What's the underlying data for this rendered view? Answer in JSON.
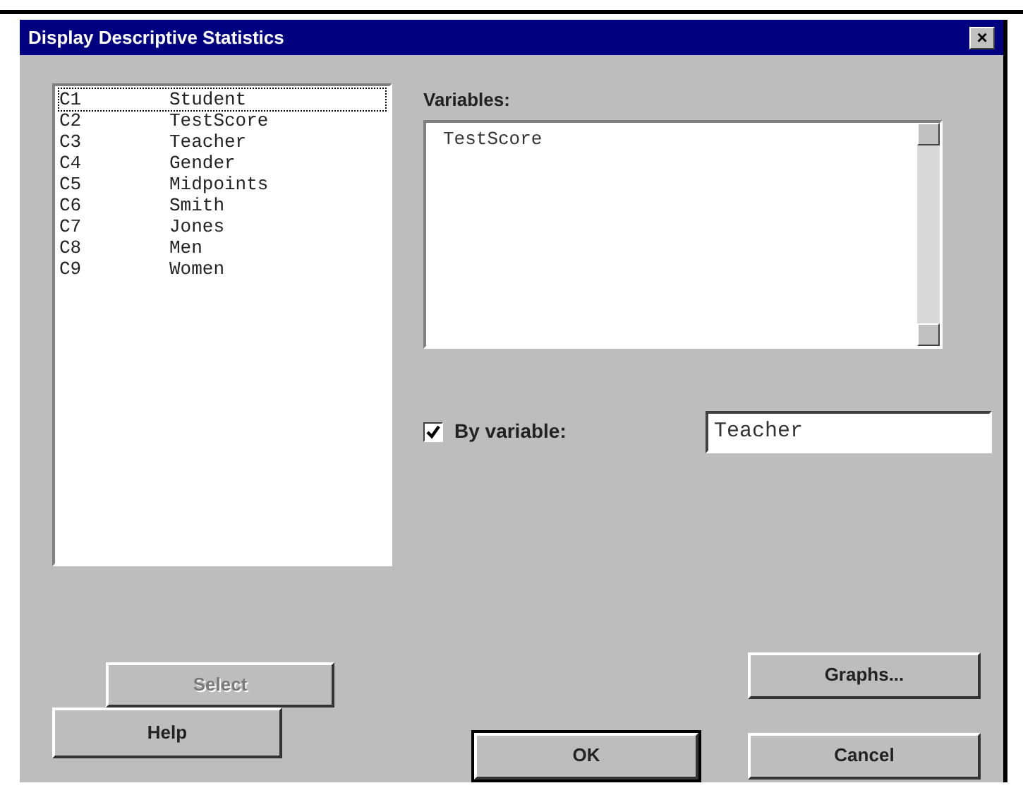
{
  "window": {
    "title": "Display Descriptive Statistics",
    "close": "×"
  },
  "columns": [
    {
      "id": "C1",
      "name": "Student",
      "selected": true
    },
    {
      "id": "C2",
      "name": "TestScore",
      "selected": false
    },
    {
      "id": "C3",
      "name": "Teacher",
      "selected": false
    },
    {
      "id": "C4",
      "name": "Gender",
      "selected": false
    },
    {
      "id": "C5",
      "name": "Midpoints",
      "selected": false
    },
    {
      "id": "C6",
      "name": "Smith",
      "selected": false
    },
    {
      "id": "C7",
      "name": "Jones",
      "selected": false
    },
    {
      "id": "C8",
      "name": "Men",
      "selected": false
    },
    {
      "id": "C9",
      "name": "Women",
      "selected": false
    }
  ],
  "variables": {
    "label": "Variables:",
    "value": "TestScore"
  },
  "by_variable": {
    "label": "By variable:",
    "checked": true,
    "value": "Teacher"
  },
  "buttons": [
    {
      "kind": "select",
      "label": "Select",
      "disabled": true
    },
    {
      "kind": "help",
      "label": "Help",
      "disabled": false
    },
    {
      "kind": "graphs",
      "label": "Graphs...",
      "disabled": false
    },
    {
      "kind": "ok",
      "label": "OK",
      "disabled": false
    },
    {
      "kind": "cancel",
      "label": "Cancel",
      "disabled": false
    }
  ]
}
